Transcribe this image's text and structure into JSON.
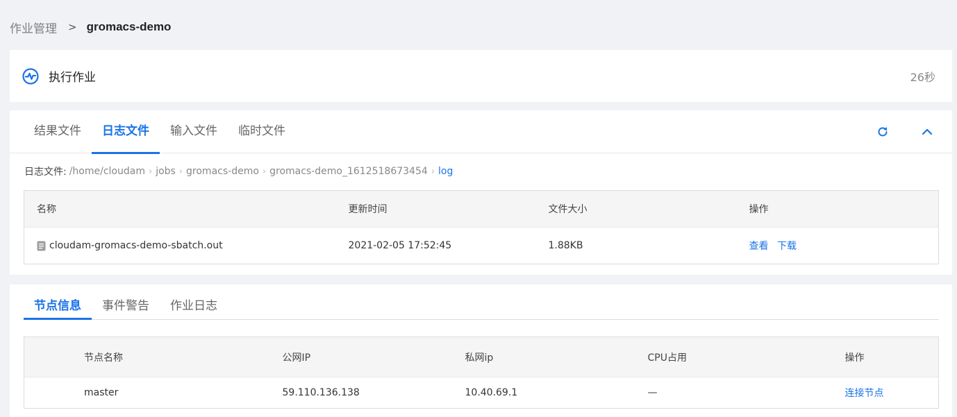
{
  "breadcrumb": {
    "parent": "作业管理",
    "separator": ">",
    "current": "gromacs-demo"
  },
  "status": {
    "title": "执行作业",
    "duration": "26秒",
    "icon": "pulse-icon",
    "accent": "#1a73e8"
  },
  "file_tabs": [
    "结果文件",
    "日志文件",
    "输入文件",
    "临时文件"
  ],
  "active_file_tab": "日志文件",
  "file_path": {
    "label": "日志文件:",
    "segments": [
      "/home/cloudam",
      "jobs",
      "gromacs-demo",
      "gromacs-demo_1612518673454",
      "log"
    ]
  },
  "files_table": {
    "columns": [
      "名称",
      "更新时间",
      "文件大小",
      "操作"
    ],
    "rows": [
      {
        "name": "cloudam-gromacs-demo-sbatch.out",
        "updated": "2021-02-05 17:52:45",
        "size": "1.88KB",
        "actions": [
          "查看",
          "下载"
        ]
      }
    ]
  },
  "node_tabs": [
    "节点信息",
    "事件警告",
    "作业日志"
  ],
  "active_node_tab": "节点信息",
  "nodes_table": {
    "columns": [
      "节点名称",
      "公网IP",
      "私网ip",
      "CPU占用",
      "操作"
    ],
    "rows": [
      {
        "name": "master",
        "public_ip": "59.110.136.138",
        "private_ip": "10.40.69.1",
        "cpu": "—",
        "action": "连接节点"
      }
    ]
  }
}
